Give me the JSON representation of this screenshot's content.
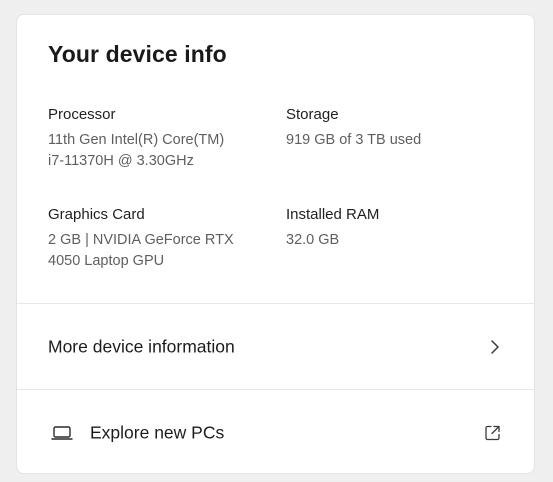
{
  "device_info": {
    "title": "Your device info",
    "specs": [
      {
        "label": "Processor",
        "value": "11th Gen Intel(R) Core(TM) i7-11370H @ 3.30GHz"
      },
      {
        "label": "Storage",
        "value": "919 GB of 3 TB used"
      },
      {
        "label": "Graphics Card",
        "value": "2 GB | NVIDIA GeForce RTX 4050 Laptop GPU"
      },
      {
        "label": "Installed RAM",
        "value": "32.0 GB"
      }
    ]
  },
  "links": {
    "more_info": {
      "label": "More device information",
      "icon": "chevron-right-icon"
    },
    "explore": {
      "label": "Explore new PCs",
      "icon": "laptop-icon",
      "action_icon": "external-link-icon"
    }
  }
}
